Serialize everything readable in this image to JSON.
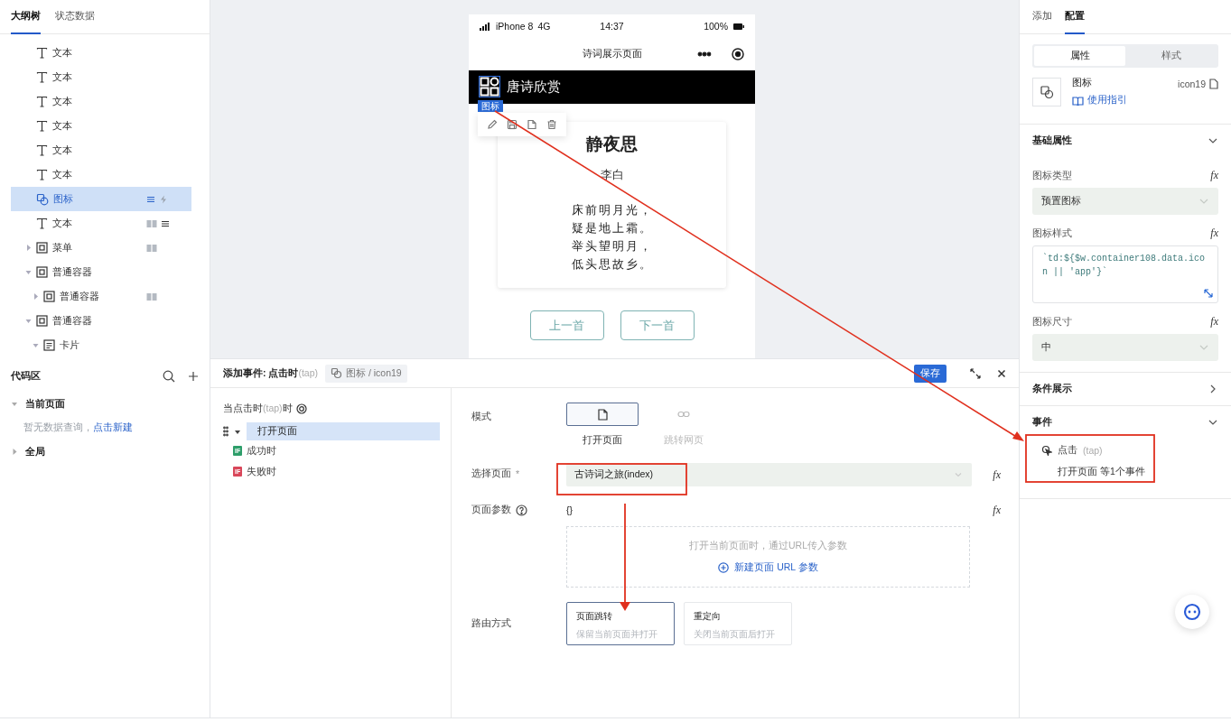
{
  "outline": {
    "tabs": [
      {
        "label": "大纲树",
        "selected": true
      },
      {
        "label": "状态数据",
        "selected": false
      }
    ],
    "tree": [
      {
        "kind": "text",
        "label": "文本",
        "selected": false
      },
      {
        "kind": "text",
        "label": "文本",
        "selected": false
      },
      {
        "kind": "text",
        "label": "文本",
        "selected": false
      },
      {
        "kind": "text",
        "label": "文本",
        "selected": false
      },
      {
        "kind": "text",
        "label": "文本",
        "selected": false
      },
      {
        "kind": "text",
        "label": "文本",
        "selected": false
      },
      {
        "kind": "icon",
        "label": "图标",
        "selected": true,
        "styled": true,
        "has_event": true
      },
      {
        "kind": "text",
        "label": "文本",
        "selected": false,
        "data_bound": true,
        "styled": true
      },
      {
        "kind": "container",
        "label": "菜单",
        "selected": false,
        "expanded": false,
        "data_bound": true
      },
      {
        "kind": "container",
        "label": "普通容器",
        "selected": false,
        "expanded": true,
        "children": [
          {
            "kind": "container",
            "label": "普通容器",
            "selected": false,
            "expanded": false,
            "data_bound": true
          }
        ]
      },
      {
        "kind": "container",
        "label": "普通容器",
        "selected": false,
        "expanded": true,
        "children": [
          {
            "kind": "card",
            "label": "卡片",
            "selected": false,
            "expanded": true
          }
        ]
      }
    ]
  },
  "canvas": {
    "status": {
      "carrier": "iPhone 8",
      "network": "4G",
      "time": "14:37",
      "battery": "100%"
    },
    "nav_title": "诗词展示页面",
    "header_title": "唐诗欣赏",
    "selection_badge": "图标",
    "poem": {
      "title": "静夜思",
      "author": "李白",
      "lines": [
        "床前明月光，",
        "疑是地上霜。",
        "举头望明月，",
        "低头思故乡。"
      ]
    },
    "buttons": [
      "上一首",
      "下一首"
    ]
  },
  "config": {
    "tabs": [
      {
        "label": "添加",
        "selected": false
      },
      {
        "label": "配置",
        "selected": true
      }
    ],
    "view_switch": [
      {
        "label": "属性",
        "selected": true
      },
      {
        "label": "样式",
        "selected": false
      }
    ],
    "component": {
      "name": "图标",
      "guide_link": "使用指引",
      "id": "icon19"
    },
    "sections": [
      {
        "title": "基础属性",
        "expanded": true,
        "fields": [
          {
            "kind": "select",
            "label": "图标类型",
            "formula": "fx",
            "value": "预置图标"
          },
          {
            "kind": "code",
            "label": "图标样式",
            "formula": "fx",
            "value": "`td:${$w.container108.data.icon || 'app'}`"
          },
          {
            "kind": "select",
            "label": "图标尺寸",
            "formula": "fx",
            "value": "中"
          }
        ]
      },
      {
        "title": "条件展示",
        "expanded": false
      },
      {
        "title": "事件",
        "expanded": true,
        "events": [
          {
            "name": "点击",
            "trigger": "(tap)",
            "summary": "打开页面 等1个事件"
          }
        ]
      }
    ]
  },
  "code_area": {
    "title": "代码区",
    "groups": [
      {
        "label": "当前页面",
        "expanded": true,
        "empty_note": "暂无数据查询，",
        "create_link": "点击新建"
      },
      {
        "label": "全局",
        "expanded": false
      }
    ]
  },
  "event_editor": {
    "title": "添加事件: 点击时",
    "title_hint": "(tap)",
    "target": "图标 / icon19",
    "save": "保存",
    "trigger": {
      "before": "当点击时",
      "hint": "(tap)",
      "after": "时"
    },
    "actions": [
      {
        "label": "打开页面",
        "selected": true,
        "expanded": true,
        "children": [
          {
            "badge": "IF",
            "label": "成功时",
            "color": "#2e9e6a"
          },
          {
            "badge": "IF",
            "label": "失败时",
            "color": "#d9475a"
          }
        ]
      }
    ],
    "form": {
      "mode": {
        "label": "模式",
        "options": [
          {
            "label": "打开页面",
            "kind": "page",
            "selected": true
          },
          {
            "label": "跳转网页",
            "kind": "link",
            "selected": false
          }
        ]
      },
      "page": {
        "label": "选择页面",
        "required_mark": "*",
        "value": "古诗词之旅(index)",
        "formula": "fx"
      },
      "params": {
        "label": "页面参数",
        "value": "{}",
        "formula": "fx",
        "hint": "打开当前页面时，通过URL传入参数",
        "add_link": "新建页面 URL 参数"
      },
      "route": {
        "label": "路由方式",
        "options": [
          {
            "title": "页面跳转",
            "description": "保留当前页面并打开",
            "selected": true
          },
          {
            "title": "重定向",
            "description": "关闭当前页面后打开",
            "selected": false
          }
        ]
      }
    }
  }
}
